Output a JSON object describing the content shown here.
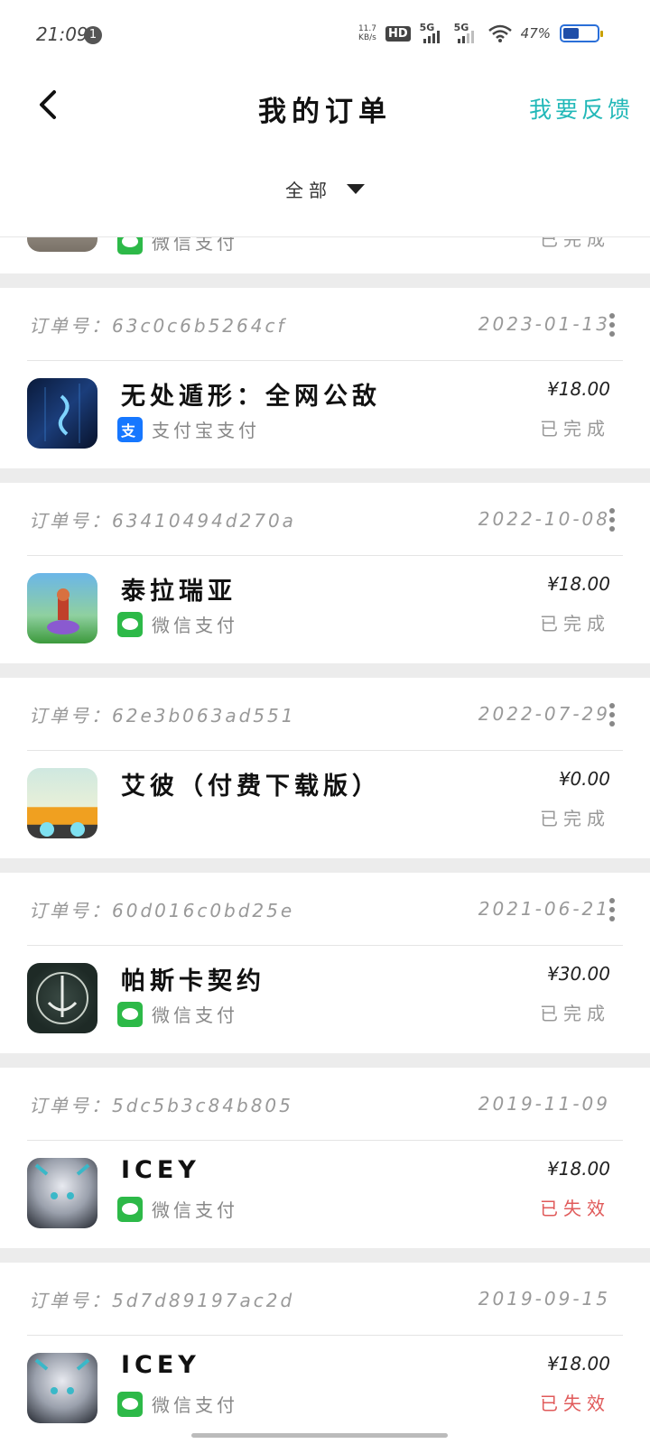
{
  "status_bar": {
    "time": "21:09",
    "notification_count": "1",
    "net_speed_value": "11.7",
    "net_speed_unit": "KB/s",
    "hd": "HD",
    "signal1": "5G",
    "signal2": "5G",
    "battery_percent": "47%",
    "battery_level": 0.47
  },
  "nav": {
    "title": "我的订单",
    "feedback": "我要反馈"
  },
  "filter": {
    "selected": "全部"
  },
  "partial_order": {
    "payment": "微信支付",
    "status": "已完成"
  },
  "orders": [
    {
      "order_label": "订单号：63c0c6b5264cf",
      "date": "2023-01-13",
      "name": "无处遁形：全网公敌",
      "payment": "支付宝支付",
      "payment_icon": "alipay-icon",
      "price": "¥18.00",
      "status": "已完成"
    },
    {
      "order_label": "订单号：63410494d270a",
      "date": "2022-10-08",
      "name": "泰拉瑞亚",
      "payment": "微信支付",
      "payment_icon": "wechat-pay-icon",
      "price": "¥18.00",
      "status": "已完成"
    },
    {
      "order_label": "订单号：62e3b063ad551",
      "date": "2022-07-29",
      "name": "艾彼（付费下载版）",
      "payment": "",
      "payment_icon": "",
      "price": "¥0.00",
      "status": "已完成"
    },
    {
      "order_label": "订单号：60d016c0bd25e",
      "date": "2021-06-21",
      "name": "帕斯卡契约",
      "payment": "微信支付",
      "payment_icon": "wechat-pay-icon",
      "price": "¥30.00",
      "status": "已完成"
    },
    {
      "order_label": "订单号：5dc5b3c84b805",
      "date": "2019-11-09",
      "name": "ICEY",
      "payment": "微信支付",
      "payment_icon": "wechat-pay-icon",
      "price": "¥18.00",
      "status": "已失效"
    },
    {
      "order_label": "订单号：5d7d89197ac2d",
      "date": "2019-09-15",
      "name": "ICEY",
      "payment": "微信支付",
      "payment_icon": "wechat-pay-icon",
      "price": "¥18.00",
      "status": "已失效"
    }
  ],
  "colors": {
    "accent": "#22b8b8",
    "invalid": "#e05a5a",
    "wechat": "#2db948",
    "alipay": "#1677ff"
  }
}
